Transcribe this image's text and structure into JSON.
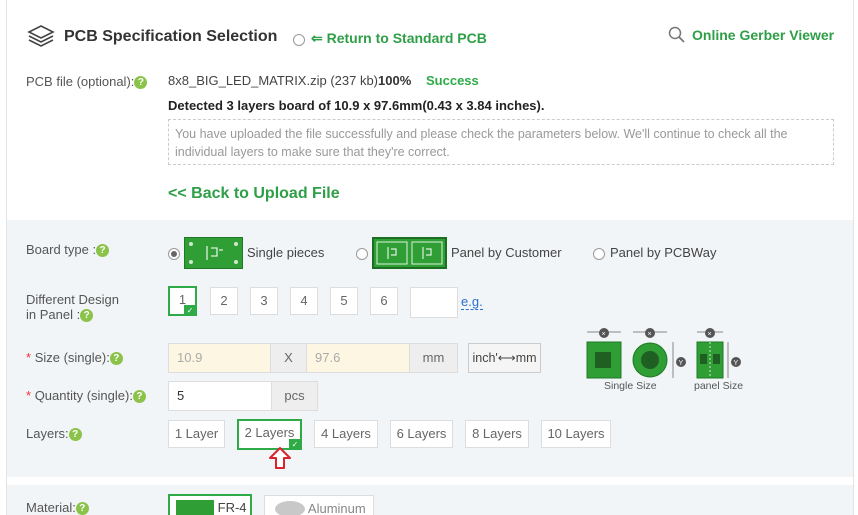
{
  "header": {
    "title": "PCB Specification Selection",
    "return_link": "⇐ Return to Standard PCB",
    "gerber_viewer": "Online Gerber Viewer"
  },
  "pcb_file": {
    "label": "PCB file (optional):",
    "filename": "8x8_BIG_LED_MATRIX.zip (237 kb)",
    "percent": "100%",
    "status": "Success",
    "detected": "Detected 3 layers board of 10.9 x 97.6mm(0.43 x 3.84 inches).",
    "notice": "You have uploaded the file successfully and please check the parameters below. We'll continue to check all the individual layers to make sure that they're correct.",
    "back_link": "<< Back to Upload File"
  },
  "board_type": {
    "label": "Board type :",
    "options": [
      "Single pieces",
      "Panel by Customer",
      "Panel by PCBWay"
    ],
    "selected": "Single pieces"
  },
  "different_design": {
    "label_line1": "Different Design",
    "label_line2": "in Panel :",
    "options": [
      "1",
      "2",
      "3",
      "4",
      "5",
      "6"
    ],
    "selected": "1",
    "eg": "e.g."
  },
  "size": {
    "label": "Size (single):",
    "required_mark": "*",
    "x_value": "10.9",
    "separator": "X",
    "y_value": "97.6",
    "unit": "mm",
    "unit_toggle": "inch'⟷mm",
    "single_size_caption": "Single Size",
    "panel_size_caption": "panel Size"
  },
  "quantity": {
    "label": "Quantity (single):",
    "required_mark": "*",
    "value": "5",
    "unit": "pcs"
  },
  "layers": {
    "label": "Layers:",
    "options": [
      "1 Layer",
      "2 Layers",
      "4 Layers",
      "6 Layers",
      "8 Layers",
      "10 Layers"
    ],
    "selected": "2 Layers"
  },
  "material": {
    "label": "Material:",
    "options": [
      "FR-4",
      "Aluminum"
    ],
    "selected": "FR-4"
  },
  "colors": {
    "accent": "#2e9e47",
    "required": "#e33333",
    "arrow": "#d9232d"
  }
}
